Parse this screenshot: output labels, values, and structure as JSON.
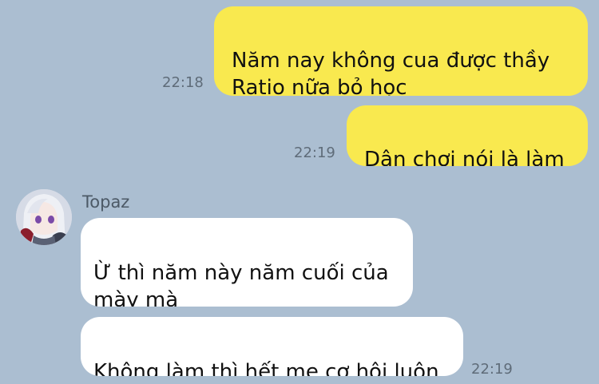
{
  "messages": {
    "m1": {
      "text": "Năm nay không cua được thầy\nRatio nữa bỏ học",
      "time": "22:18"
    },
    "m2": {
      "text": "Dân chơi nói là làm",
      "time": "22:19"
    },
    "contact": {
      "name": "Topaz"
    },
    "m3": {
      "text": "Ừ thì năm này năm cuối của\nmày mà"
    },
    "m4": {
      "text": "Không làm thì hết mẹ cơ hội luôn",
      "time": "22:19"
    }
  },
  "colors": {
    "background": "#abbed1",
    "outgoing_bubble": "#f9e94f",
    "incoming_bubble": "#ffffff",
    "timestamp": "#5f6c79"
  },
  "icons": {
    "avatar": "contact-avatar-image"
  }
}
